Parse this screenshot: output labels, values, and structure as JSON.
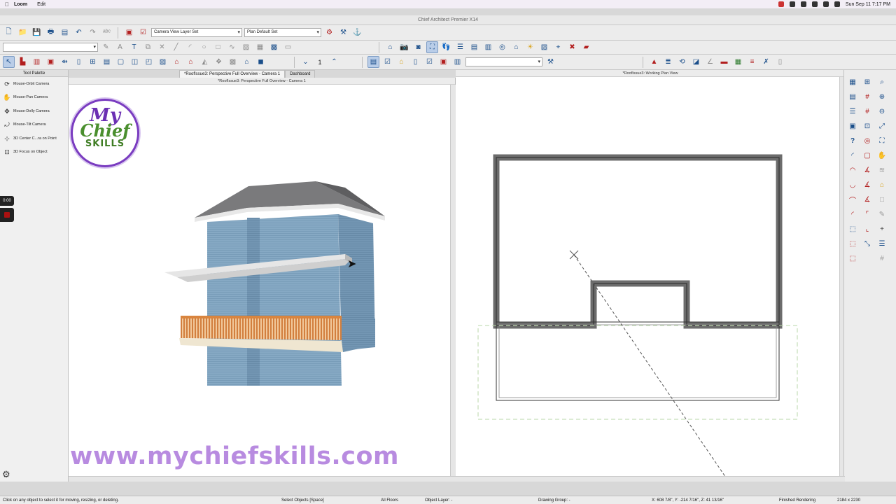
{
  "menubar": {
    "app": "Loom",
    "menu_edit": "Edit",
    "clock": "Sun Sep 11  7:17 PM"
  },
  "window": {
    "title": "Chief Architect Premier X14"
  },
  "toolbar": {
    "layer_set": "Camera View Layer Set",
    "plan_set": "Plan Default Set",
    "floor_number": "1"
  },
  "tabs": [
    {
      "label": "*RoofIssue3: Perspective Full Overview - Camera 1"
    },
    {
      "label": "Dashboard"
    }
  ],
  "palette": {
    "title": "Tool Palette",
    "items": [
      {
        "label": "Mouse-Orbit Camera",
        "icon": "orbit-icon"
      },
      {
        "label": "Mouse-Pan Camera",
        "icon": "hand-icon"
      },
      {
        "label": "Mouse-Dolly Camera",
        "icon": "dolly-icon"
      },
      {
        "label": "Mouse-Tilt Camera",
        "icon": "tilt-icon"
      },
      {
        "label": "3D Center C...ra on Point",
        "icon": "center-icon"
      },
      {
        "label": "3D Focus on Object",
        "icon": "focus-icon"
      }
    ]
  },
  "recorder": {
    "time": "0:00"
  },
  "view3d": {
    "title": "*RoofIssue3: Perspective Full Overview - Camera 1"
  },
  "plan": {
    "title": "*RoofIssue3:  Working Plan View"
  },
  "logo": {
    "line1": "My",
    "line2": "Chief",
    "line3": "SKILLS"
  },
  "watermark": "www.mychiefskills.com",
  "status": {
    "hint": "Click on any object to select it for moving, resizing, or deleting.",
    "mode": "Select Objects [Space]",
    "floors": "All Floors",
    "object_layer": "Object Layer: -",
    "drawing_group": "Drawing Group: -",
    "coords": "X: 608 7/8\", Y: -214 7/16\", Z: 41 13/16\"",
    "rendering": "Finished Rendering",
    "size": "2184 x 2230"
  },
  "colors": {
    "accent": "#7a3cc0",
    "siding": "#7fa3bf",
    "railing": "#d98b4a",
    "watermark": "#b88be0"
  }
}
